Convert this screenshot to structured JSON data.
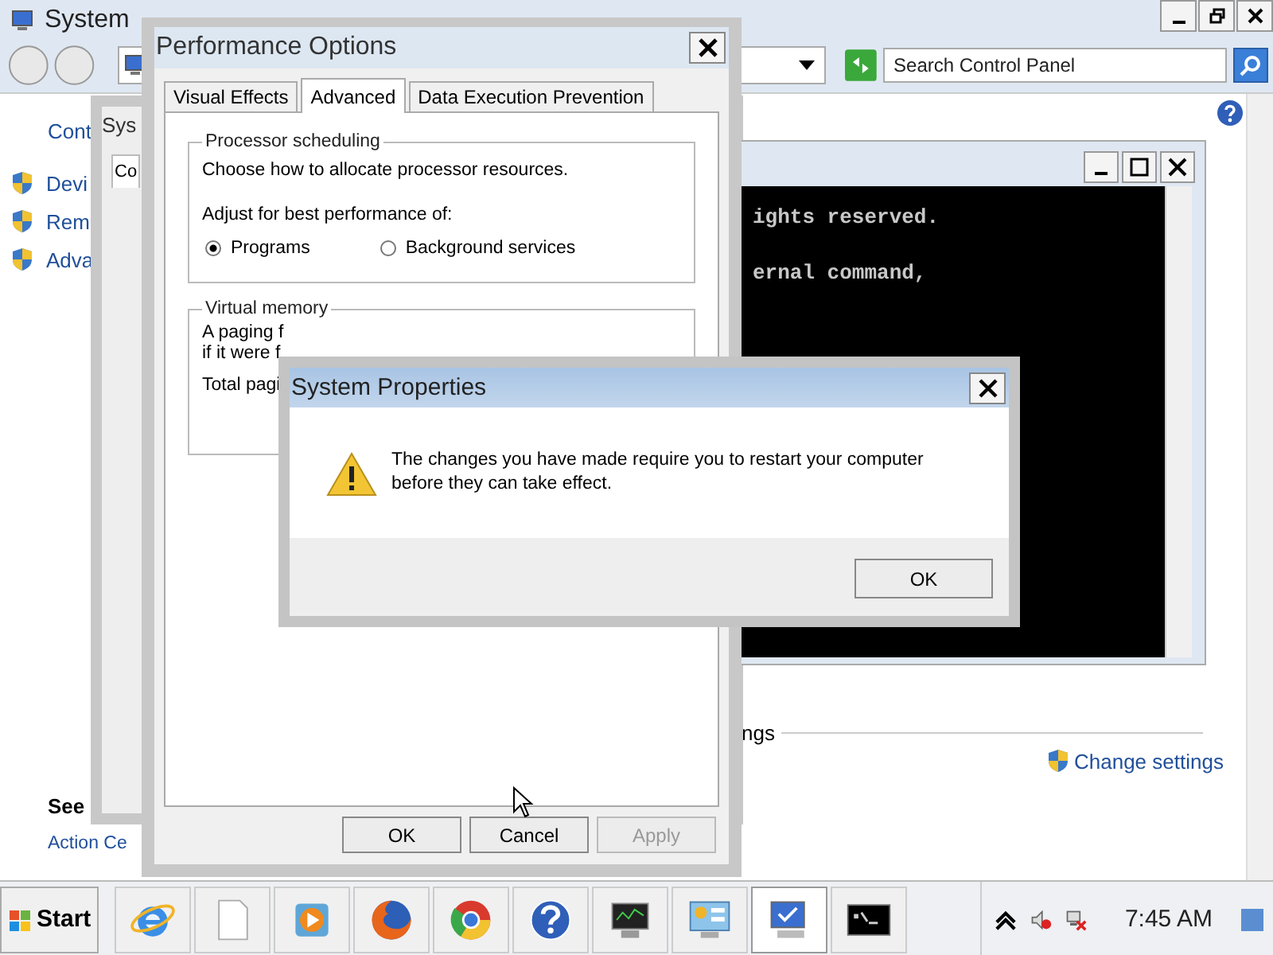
{
  "system_window": {
    "title": "System",
    "search": {
      "placeholder": "Search Control Panel"
    },
    "sidebar": {
      "home_link": "Cont",
      "tasks": [
        {
          "label": "Devi"
        },
        {
          "label": "Rem"
        },
        {
          "label": "Adva"
        }
      ],
      "see_also_heading": "See",
      "see_also_links": [
        "Action Ce"
      ]
    },
    "section_heading": "ngs",
    "change_settings": "Change settings"
  },
  "system_properties_behind": {
    "title": "Sys",
    "tab": "Co"
  },
  "console": {
    "lines": [
      "ights reserved.",
      "ernal command,"
    ]
  },
  "performance_options": {
    "title": "Performance Options",
    "tabs": [
      {
        "label": "Visual Effects",
        "selected": false
      },
      {
        "label": "Advanced",
        "selected": true
      },
      {
        "label": "Data Execution Prevention",
        "selected": false
      }
    ],
    "processor_scheduling": {
      "legend": "Processor scheduling",
      "description": "Choose how to allocate processor resources.",
      "adjust_label": "Adjust for best performance of:",
      "options": [
        {
          "label": "Programs",
          "selected": true
        },
        {
          "label": "Background services",
          "selected": false
        }
      ]
    },
    "virtual_memory": {
      "legend": "Virtual memory",
      "lines": [
        "A paging f",
        "if it were f",
        "Total pagi"
      ]
    },
    "buttons": [
      {
        "label": "OK",
        "disabled": false
      },
      {
        "label": "Cancel",
        "disabled": false
      },
      {
        "label": "Apply",
        "disabled": true
      }
    ]
  },
  "alert": {
    "title": "System Properties",
    "message": "The changes you have made require you to restart your computer before they can take effect.",
    "button": "OK"
  },
  "taskbar": {
    "start": "Start",
    "apps": [
      {
        "kind": "e-browser",
        "active": false
      },
      {
        "kind": "document",
        "active": false
      },
      {
        "kind": "media-player",
        "active": false
      },
      {
        "kind": "orange-globe",
        "active": false
      },
      {
        "kind": "round-browser",
        "active": false
      },
      {
        "kind": "help",
        "active": false
      },
      {
        "kind": "monitor",
        "active": false
      },
      {
        "kind": "control-panel",
        "active": false
      },
      {
        "kind": "computer",
        "active": true
      },
      {
        "kind": "console",
        "active": false
      }
    ],
    "clock": "7:45 AM"
  }
}
